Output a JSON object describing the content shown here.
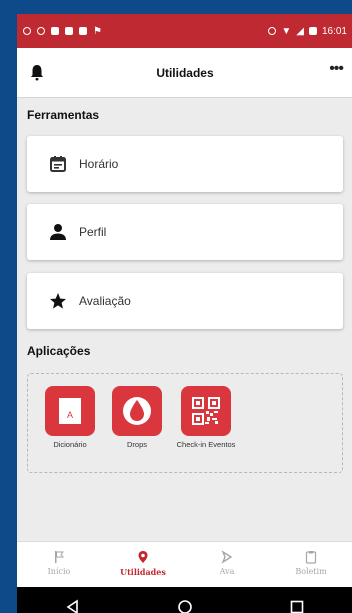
{
  "status_bar": {
    "time": "16:01"
  },
  "header": {
    "title": "Utilidades",
    "more_label": "•••"
  },
  "ferramentas": {
    "title": "Ferramentas",
    "items": [
      {
        "label": "Horário",
        "icon": "calendar-icon"
      },
      {
        "label": "Perfil",
        "icon": "person-icon"
      },
      {
        "label": "Avaliação",
        "icon": "star-icon"
      }
    ]
  },
  "aplicacoes": {
    "title": "Aplicações",
    "apps": [
      {
        "label": "Dicionário",
        "icon": "dictionary-icon"
      },
      {
        "label": "Drops",
        "icon": "drop-icon"
      },
      {
        "label": "Check-in Eventos",
        "icon": "qr-code-icon"
      }
    ]
  },
  "tabs": [
    {
      "label": "Início",
      "icon": "flag-icon",
      "active": false
    },
    {
      "label": "Utilidades",
      "icon": "location-pin-icon",
      "active": true
    },
    {
      "label": "Ava",
      "icon": "arrow-icon",
      "active": false
    },
    {
      "label": "Boletim",
      "icon": "clipboard-icon",
      "active": false
    }
  ],
  "colors": {
    "brand": "#c1272d",
    "app_tile": "#d9363e",
    "outer_bg": "#0e4a8a"
  }
}
